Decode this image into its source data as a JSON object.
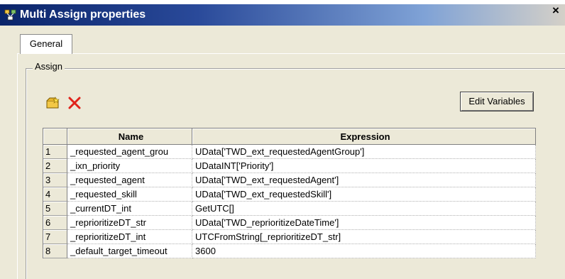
{
  "window": {
    "title": "Multi Assign properties",
    "close_glyph": "×",
    "title_icon": "tree-properties-icon"
  },
  "tabs": [
    {
      "label": "General",
      "active": true
    }
  ],
  "group": {
    "label": "Assign",
    "toolbar": {
      "add_icon": "add-variable-icon",
      "delete_icon": "delete-icon",
      "edit_variables_label": "Edit Variables"
    }
  },
  "grid": {
    "columns": [
      "",
      "Name",
      "Expression"
    ],
    "rows": [
      {
        "num": "1",
        "name": "_requested_agent_grou",
        "expression": "UData['TWD_ext_requestedAgentGroup']"
      },
      {
        "num": "2",
        "name": "_ixn_priority",
        "expression": "UDataINT['Priority']"
      },
      {
        "num": "3",
        "name": "_requested_agent",
        "expression": "UData['TWD_ext_requestedAgent']"
      },
      {
        "num": "4",
        "name": "_requested_skill",
        "expression": "UData['TWD_ext_requestedSkill']"
      },
      {
        "num": "5",
        "name": "_currentDT_int",
        "expression": "GetUTC[]"
      },
      {
        "num": "6",
        "name": "_reprioritizeDT_str",
        "expression": "UData['TWD_reprioritizeDateTime']"
      },
      {
        "num": "7",
        "name": "_reprioritizeDT_int",
        "expression": "UTCFromString[_reprioritizeDT_str]"
      },
      {
        "num": "8",
        "name": "_default_target_timeout",
        "expression": "3600"
      }
    ]
  },
  "colors": {
    "titlebar_start": "#0a246a",
    "dialog_bg": "#ece9d8",
    "delete_red": "#e0231b"
  }
}
